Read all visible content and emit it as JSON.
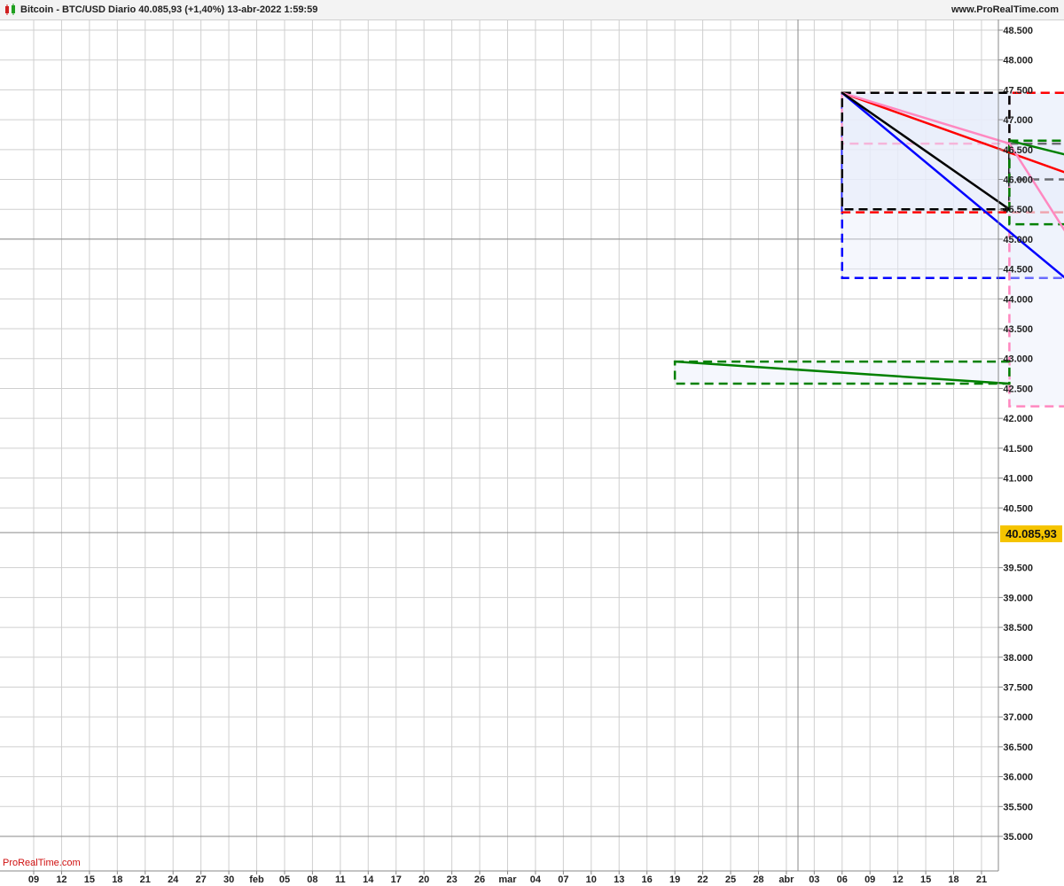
{
  "header": {
    "title": "Bitcoin - BTC/USD Diario 40.085,93 (+1,40%) 13-abr-2022 1:59:59",
    "site": "www.ProRealTime.com"
  },
  "watermark": "ProRealTime.com",
  "price_badge": "40.085,93",
  "colors": {
    "grid": "#cfcfcf",
    "axis_line": "#888888",
    "price_badge": "#f5c400",
    "box_fill": "#e8eefa",
    "blue": "#0000ff",
    "red": "#ff0000",
    "green": "#008000",
    "black": "#000000",
    "pink": "#ff88c0",
    "watermark": "#d01010"
  },
  "chart_data": {
    "type": "line",
    "x_ticks": [
      "09",
      "12",
      "15",
      "18",
      "21",
      "24",
      "27",
      "30",
      "feb",
      "05",
      "08",
      "11",
      "14",
      "17",
      "20",
      "23",
      "26",
      "mar",
      "04",
      "07",
      "10",
      "13",
      "16",
      "19",
      "22",
      "25",
      "28",
      "abr",
      "03",
      "06",
      "09",
      "12",
      "15",
      "18",
      "21"
    ],
    "y_ticks": [
      "48.500",
      "48.000",
      "47.500",
      "47.000",
      "46.500",
      "46.000",
      "45.500",
      "45.000",
      "44.500",
      "44.000",
      "43.500",
      "43.000",
      "42.500",
      "42.000",
      "41.500",
      "41.000",
      "40.500",
      "39.500",
      "39.000",
      "38.500",
      "38.000",
      "37.500",
      "37.000",
      "36.500",
      "36.000",
      "35.500",
      "35.000"
    ],
    "ylim": [
      34500,
      48800
    ],
    "y_reference_lines": [
      45000,
      35000
    ],
    "last_price": 40085.93,
    "series": [],
    "annotations": [
      {
        "kind": "line",
        "color": "blue",
        "from": [
          29,
          47450
        ],
        "to": [
          37,
          44350
        ]
      },
      {
        "kind": "line",
        "color": "red",
        "from": [
          29,
          47450
        ],
        "to": [
          41,
          45450
        ]
      },
      {
        "kind": "line",
        "color": "pink",
        "from": [
          29,
          47450
        ],
        "to": [
          35,
          46600
        ]
      },
      {
        "kind": "line",
        "color": "pink",
        "from": [
          35,
          46600
        ],
        "to": [
          41,
          42200
        ]
      },
      {
        "kind": "line",
        "color": "black",
        "from": [
          29,
          47450
        ],
        "to": [
          35,
          45500
        ]
      },
      {
        "kind": "line",
        "color": "green",
        "from": [
          35,
          46650
        ],
        "to": [
          47,
          45250
        ]
      },
      {
        "kind": "line",
        "color": "green",
        "from": [
          23,
          42950
        ],
        "to": [
          35,
          42580
        ]
      },
      {
        "kind": "line",
        "color": "black",
        "from": [
          41,
          42200
        ],
        "to": [
          47,
          44600
        ]
      },
      {
        "kind": "box",
        "color": "blue",
        "from": [
          29,
          47450
        ],
        "to": [
          37,
          44350
        ]
      },
      {
        "kind": "box",
        "color": "red",
        "from": [
          29,
          47450
        ],
        "to": [
          41,
          45450
        ]
      },
      {
        "kind": "box",
        "color": "pink",
        "from": [
          29,
          46600
        ],
        "to": [
          35,
          47450
        ]
      },
      {
        "kind": "box",
        "color": "black",
        "from": [
          29,
          47450
        ],
        "to": [
          35,
          45500
        ]
      },
      {
        "kind": "box",
        "color": "pink",
        "from": [
          35,
          46600
        ],
        "to": [
          41,
          42200
        ]
      },
      {
        "kind": "box",
        "color": "black",
        "from": [
          35,
          46600
        ],
        "to": [
          41,
          46000
        ]
      },
      {
        "kind": "box",
        "color": "green",
        "from": [
          35,
          46650
        ],
        "to": [
          47,
          45250
        ]
      },
      {
        "kind": "box",
        "color": "green",
        "from": [
          23,
          42950
        ],
        "to": [
          35,
          42580
        ]
      },
      {
        "kind": "box",
        "color": "black",
        "from": [
          41,
          44600
        ],
        "to": [
          47,
          42200
        ]
      }
    ]
  }
}
